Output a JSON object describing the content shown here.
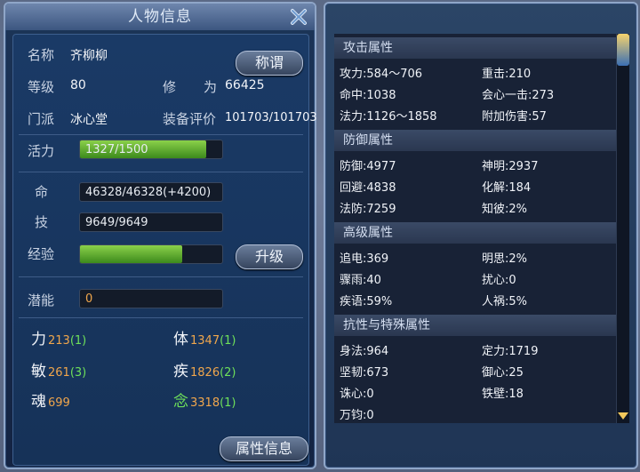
{
  "window": {
    "title": "人物信息"
  },
  "profile": {
    "name_label": "名称",
    "name": "齐柳柳",
    "title_button": "称谓",
    "level_label": "等级",
    "level": "80",
    "cultivation_label_1": "修",
    "cultivation_label_2": "为",
    "cultivation": "66425",
    "sect_label": "门派",
    "sect": "冰心堂",
    "gear_label": "装备评价",
    "gear_score": "101703/101703",
    "vitality_label": "活力",
    "vitality": "1327/1500",
    "vitality_fraction": 0.885
  },
  "bars": {
    "life_label": "命",
    "life": "46328/46328(+4200)",
    "skill_label": "技",
    "skill": "9649/9649",
    "exp_label": "经验",
    "exp_fraction": 0.72,
    "levelup_button": "升级",
    "potential_label": "潜能",
    "potential": "0"
  },
  "attributes": [
    {
      "name": "力",
      "value": "213",
      "bonus": "(1)"
    },
    {
      "name": "体",
      "value": "1347",
      "bonus": "(1)"
    },
    {
      "name": "敏",
      "value": "261",
      "bonus": "(3)"
    },
    {
      "name": "疾",
      "value": "1826",
      "bonus": "(2)"
    },
    {
      "name": "魂",
      "value": "699",
      "bonus": ""
    },
    {
      "name": "念",
      "value": "3318",
      "bonus": "(1)"
    }
  ],
  "footer": {
    "attr_info_button": "属性信息"
  },
  "stats": {
    "attack_header": "攻击属性",
    "attack": [
      "攻力:584～706",
      "重击:210",
      "命中:1038",
      "会心一击:273",
      "法力:1126～1858",
      "附加伤害:57"
    ],
    "defense_header": "防御属性",
    "defense": [
      "防御:4977",
      "神明:2937",
      "回避:4838",
      "化解:184",
      "法防:7259",
      "知彼:2%"
    ],
    "advanced_header": "高级属性",
    "advanced": [
      "追电:369",
      "明思:2%",
      "骤雨:40",
      "扰心:0",
      "疾语:59%",
      "人祸:5%"
    ],
    "resist_header": "抗性与特殊属性",
    "resist": [
      "身法:964",
      "定力:1719",
      "坚韧:673",
      "御心:25",
      "诛心:0",
      "铁壁:18",
      "万钧:0"
    ]
  },
  "colors": {
    "accent_green": "#6ee05a",
    "attr_orange": "#f0a64c",
    "panel_border": "#8fa6c8"
  }
}
